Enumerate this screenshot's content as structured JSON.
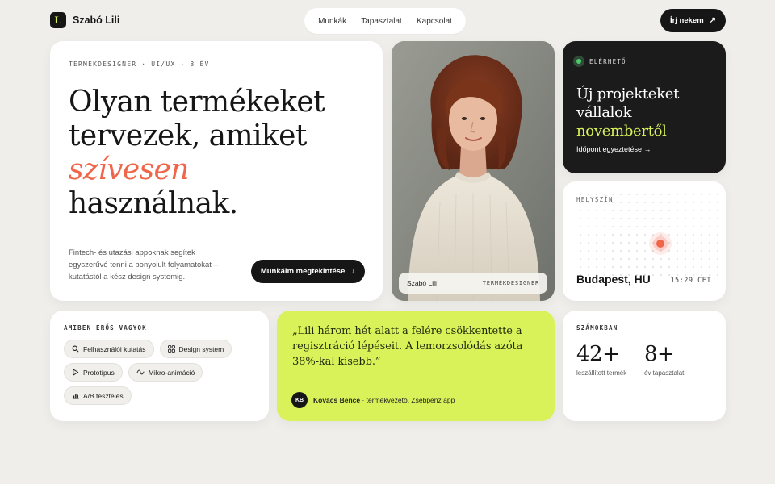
{
  "brand": {
    "logo_letter": "L",
    "name": "Szabó Lili",
    "accent": "#d9f25a"
  },
  "nav": {
    "items": [
      "Munkák",
      "Tapasztalat",
      "Kapcsolat"
    ]
  },
  "header_cta": {
    "label": "Írj nekem",
    "icon": "arrow-up-right-icon"
  },
  "hero": {
    "eyebrow": "TERMÉKDESIGNER · UI/UX · 8 ÉV",
    "title_line1": "Olyan termékeket",
    "title_line2": "tervezek, amiket",
    "title_accent": "szívesen",
    "title_line4": "használnak.",
    "accent_color": "#f0664a",
    "description": "Fintech- és utazási appoknak segítek egyszerűvé tenni a bonyolult folyamatokat – kutatástól a kész design systemig.",
    "button_label": "Munkáim megtekintése",
    "button_icon": "arrow-down-icon"
  },
  "portrait": {
    "name": "Szabó Lili",
    "role": "TERMÉKDESIGNER"
  },
  "availability": {
    "badge": "ELÉRHETŐ",
    "title": "Új projekteket vállalok",
    "title_accent": "novembertől",
    "link": "Időpont egyeztetése →"
  },
  "location": {
    "label": "HELYSZÍN",
    "city": "Budapest, HU",
    "time": "15:29 CET"
  },
  "skills": {
    "label": "AMIBEN ERŐS VAGYOK",
    "chips": [
      {
        "label": "Felhasználói kutatás",
        "icon": "search-icon"
      },
      {
        "label": "Design system",
        "icon": "grid-icon"
      },
      {
        "label": "Prototípus",
        "icon": "play-icon"
      },
      {
        "label": "Mikro-animáció",
        "icon": "wave-icon"
      },
      {
        "label": "A/B tesztelés",
        "icon": "bar-chart-icon"
      }
    ]
  },
  "quote": {
    "text": "„Lili három hét alatt a felére csökkentette a regisztráció lépéseit. A lemorzsolódás azóta 38%-kal kisebb.”",
    "author_initials": "KB",
    "author_name": "Kovács Bence",
    "author_role": " · termékvezető, Zsebpénz app"
  },
  "stats": {
    "label": "SZÁMOKBAN",
    "items": [
      {
        "value": "42+",
        "label": "leszállított termék"
      },
      {
        "value": "8+",
        "label": "év tapasztalat"
      }
    ]
  }
}
